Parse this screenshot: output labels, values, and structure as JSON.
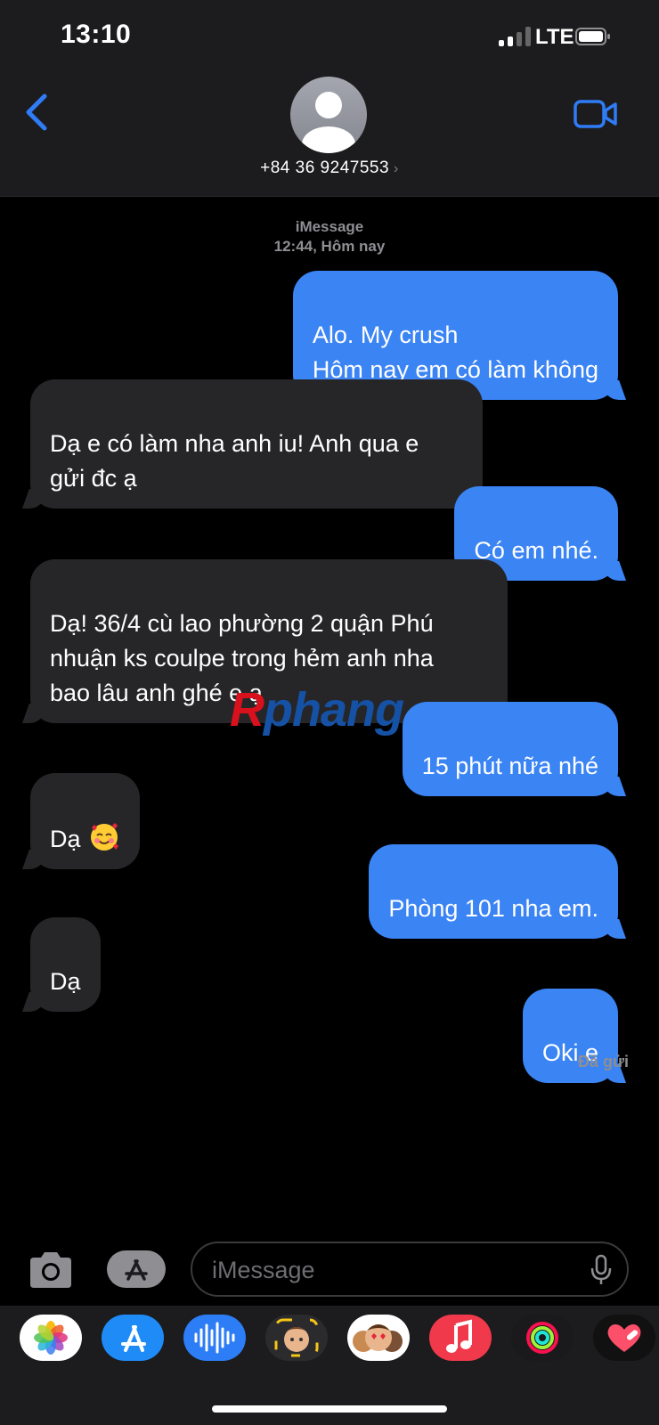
{
  "status_bar": {
    "time": "13:10",
    "carrier": "LTE"
  },
  "header": {
    "contact": "+84 36 9247553",
    "chevron": "›"
  },
  "thread": {
    "service": "iMessage",
    "timestamp": "12:44, Hôm nay",
    "messages": [
      {
        "from": "me",
        "text": "Alo. My crush\nHôm nay em có làm không"
      },
      {
        "from": "them",
        "text": "Dạ e có làm nha anh iu! Anh qua e\ngửi đc ạ"
      },
      {
        "from": "me",
        "text": "Có em nhé."
      },
      {
        "from": "them",
        "text": "Dạ! 36/4 cù lao phường 2 quận Phú\nnhuận ks coulpe trong hẻm anh nha\nbao lâu anh ghé e ạ"
      },
      {
        "from": "me",
        "text": "15 phút nữa nhé"
      },
      {
        "from": "them",
        "text": "Dạ"
      },
      {
        "from": "me",
        "text": "Phòng 101 nha em."
      },
      {
        "from": "them",
        "text": "Dạ"
      },
      {
        "from": "me",
        "text": "Oki e"
      }
    ],
    "delivered": "Đã gửi"
  },
  "watermark": {
    "first": "R",
    "rest": "phang"
  },
  "composer": {
    "placeholder": "iMessage"
  },
  "app_drawer": {
    "apps": [
      "photos-icon",
      "app-store-icon",
      "audio-message-icon",
      "memoji-icon",
      "animoji-stickers-icon",
      "music-icon",
      "activity-icon",
      "digital-touch-icon"
    ]
  },
  "colors": {
    "sent": "#3b84f4",
    "received": "#262628",
    "accent": "#2f7cf6",
    "background": "#000000"
  }
}
